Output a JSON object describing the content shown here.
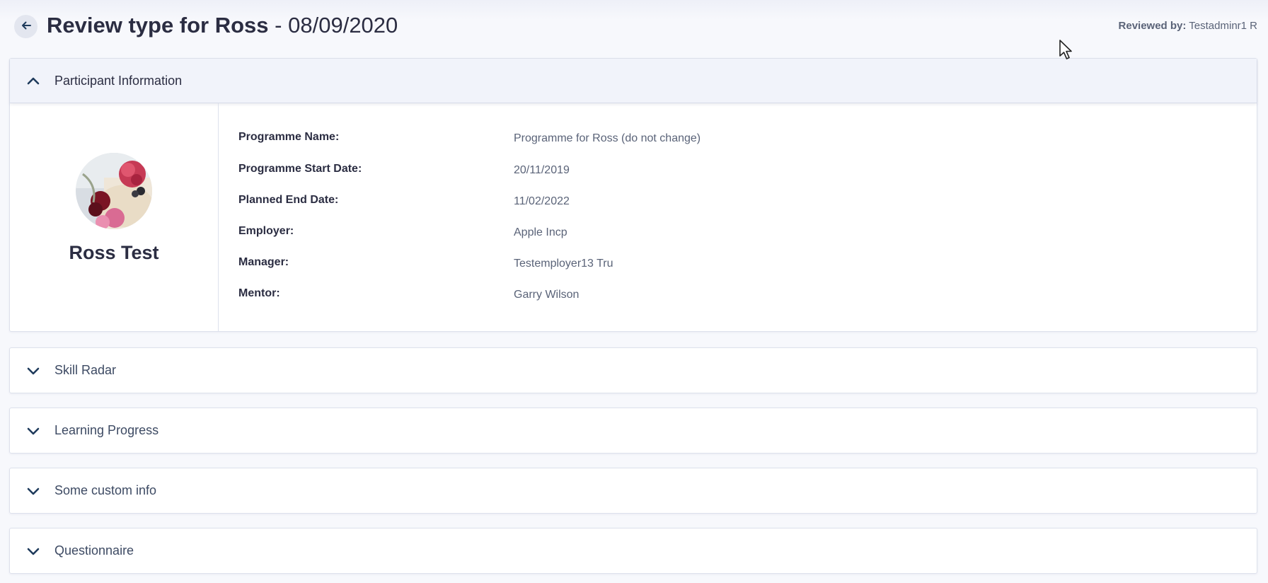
{
  "header": {
    "title_strong": "Review type for Ross",
    "separator": "-",
    "date": "08/09/2020",
    "reviewed_by_label": "Reviewed by:",
    "reviewed_by_value": "Testadminr1 R"
  },
  "participant_panel": {
    "title": "Participant Information",
    "name": "Ross Test",
    "fields": [
      {
        "label": "Programme Name:",
        "value": "Programme for Ross (do not change)"
      },
      {
        "label": "Programme Start Date:",
        "value": "20/11/2019"
      },
      {
        "label": "Planned End Date:",
        "value": "11/02/2022"
      },
      {
        "label": "Employer:",
        "value": "Apple Incp"
      },
      {
        "label": "Manager:",
        "value": "Testemployer13 Tru"
      },
      {
        "label": "Mentor:",
        "value": "Garry Wilson"
      }
    ]
  },
  "sections": [
    {
      "title": "Skill Radar"
    },
    {
      "title": "Learning Progress"
    },
    {
      "title": "Some custom info"
    },
    {
      "title": "Questionnaire"
    }
  ],
  "colors": {
    "accent": "#1f3b5c",
    "text": "#2b2d42",
    "muted": "#5a6378",
    "background": "#f7f8fc"
  },
  "icons": {
    "back": "arrow-left-icon",
    "expanded": "chevron-up-icon",
    "collapsed": "chevron-down-icon",
    "cursor": "mouse-pointer-icon"
  }
}
